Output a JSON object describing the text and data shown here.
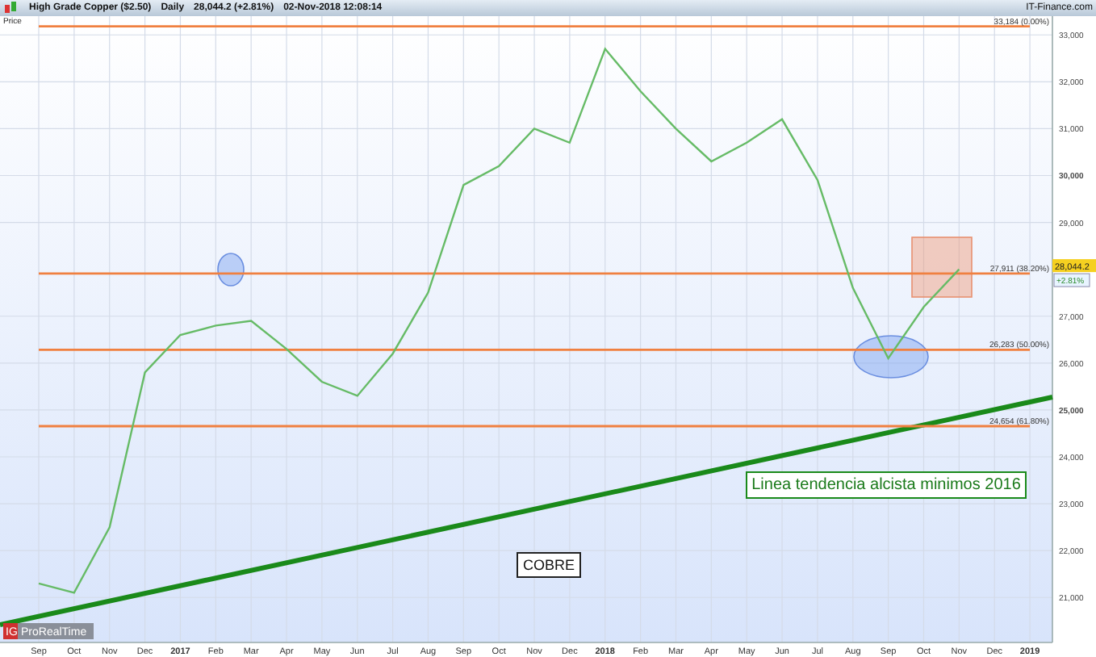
{
  "header": {
    "title": "High Grade Copper ($2.50)",
    "period": "Daily",
    "quote": "28,044.2 (+2.81%)",
    "timestamp": "02-Nov-2018 12:08:14",
    "source": "IT-Finance.com"
  },
  "panel_label": "Price",
  "chart": {
    "price_badge": "28,044.2",
    "change_badge": "+2.81%",
    "chart_data": {
      "type": "line",
      "x": [
        "Sep",
        "Oct",
        "Nov",
        "Dec",
        "2017",
        "Feb",
        "Mar",
        "Apr",
        "May",
        "Jun",
        "Jul",
        "Aug",
        "Sep",
        "Oct",
        "Nov",
        "Dec",
        "2018",
        "Feb",
        "Mar",
        "Apr",
        "May",
        "Jun",
        "Jul",
        "Aug",
        "Sep",
        "Oct",
        "Nov",
        "Dec",
        "2019"
      ],
      "series": [
        {
          "color": "#66bb66",
          "values": [
            21300,
            21100,
            22500,
            25800,
            26600,
            26800,
            26900,
            26300,
            25600,
            25300,
            26200,
            27500,
            29800,
            30200,
            31000,
            30700,
            32700,
            31800,
            31000,
            30300,
            30700,
            31200,
            29900,
            27600,
            26100,
            27200,
            28000,
            null,
            null
          ]
        },
        {
          "name": "33,184 (0.00%)",
          "color": "#f08040",
          "values": [
            33184,
            33184,
            33184,
            33184,
            33184,
            33184,
            33184,
            33184,
            33184,
            33184,
            33184,
            33184,
            33184,
            33184,
            33184,
            33184,
            33184,
            33184,
            33184,
            33184,
            33184,
            33184,
            33184,
            33184,
            33184,
            33184,
            33184,
            33184,
            33184
          ]
        },
        {
          "name": "27,911 (38.20%)",
          "color": "#f08040",
          "values": [
            27911,
            27911,
            27911,
            27911,
            27911,
            27911,
            27911,
            27911,
            27911,
            27911,
            27911,
            27911,
            27911,
            27911,
            27911,
            27911,
            27911,
            27911,
            27911,
            27911,
            27911,
            27911,
            27911,
            27911,
            27911,
            27911,
            27911,
            27911,
            27911
          ]
        },
        {
          "name": "26,283 (50.00%)",
          "color": "#f08040",
          "values": [
            26283,
            26283,
            26283,
            26283,
            26283,
            26283,
            26283,
            26283,
            26283,
            26283,
            26283,
            26283,
            26283,
            26283,
            26283,
            26283,
            26283,
            26283,
            26283,
            26283,
            26283,
            26283,
            26283,
            26283,
            26283,
            26283,
            26283,
            26283,
            26283
          ]
        },
        {
          "name": "24,654 (61.80%)",
          "color": "#f08040",
          "values": [
            24654,
            24654,
            24654,
            24654,
            24654,
            24654,
            24654,
            24654,
            24654,
            24654,
            24654,
            24654,
            24654,
            24654,
            24654,
            24654,
            24654,
            24654,
            24654,
            24654,
            24654,
            24654,
            24654,
            24654,
            24654,
            24654,
            24654,
            24654,
            24654
          ]
        }
      ],
      "ylim": [
        20040,
        33400
      ],
      "yticks": [
        {
          "value": 21000,
          "label": "21,000"
        },
        {
          "value": 22000,
          "label": "22,000"
        },
        {
          "value": 23000,
          "label": "23,000"
        },
        {
          "value": 24000,
          "label": "24,000"
        },
        {
          "value": 25000,
          "label": "25,000"
        },
        {
          "value": 26000,
          "label": "26,000"
        },
        {
          "value": 27000,
          "label": "27,000"
        },
        {
          "value": 29000,
          "label": "29,000"
        },
        {
          "value": 30000,
          "label": "30,000"
        },
        {
          "value": 31000,
          "label": "31,000"
        },
        {
          "value": 32000,
          "label": "32,000"
        },
        {
          "value": 33000,
          "label": "33,000"
        }
      ],
      "grid": true,
      "annotations": [
        "Linea tendencia alcista minimos 2016",
        "COBRE"
      ]
    }
  },
  "logo": {
    "mark": "IG",
    "text": "ProRealTime"
  }
}
